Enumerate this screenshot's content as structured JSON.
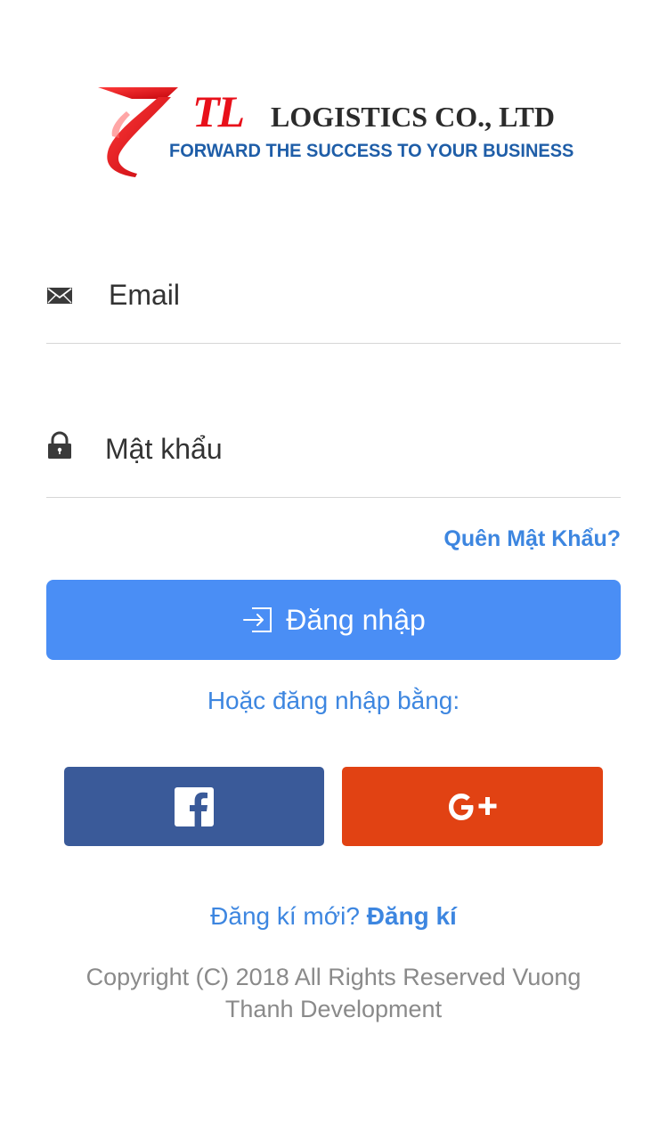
{
  "logo": {
    "mark_text": "TL",
    "company": "LOGISTICS CO., LTD",
    "tagline": "FORWARD THE SUCCESS TO YOUR BUSINESS",
    "colors": {
      "red": "#e8101a",
      "blue": "#1f5ea8",
      "dark": "#2b2b2b"
    }
  },
  "form": {
    "email": {
      "placeholder": "Email",
      "value": "",
      "icon": "mail-icon"
    },
    "password": {
      "placeholder": "Mật khẩu",
      "value": "",
      "icon": "lock-icon"
    },
    "forgot_label": "Quên Mật Khẩu?",
    "login_label": "Đăng nhập",
    "login_icon": "sign-in-icon"
  },
  "social": {
    "or_label": "Hoặc đăng nhập bằng:",
    "facebook": {
      "icon": "facebook-icon",
      "color": "#3a5a99"
    },
    "google": {
      "label": "G+",
      "icon": "google-plus-icon",
      "color": "#e14213"
    }
  },
  "register": {
    "prompt": "Đăng kí mới?",
    "link_label": "Đăng kí"
  },
  "footer": {
    "copyright": "Copyright (C) 2018 All Rights Reserved Vuong Thanh Development"
  },
  "theme": {
    "accent": "#4a8ef5",
    "link": "#3d86e0"
  }
}
